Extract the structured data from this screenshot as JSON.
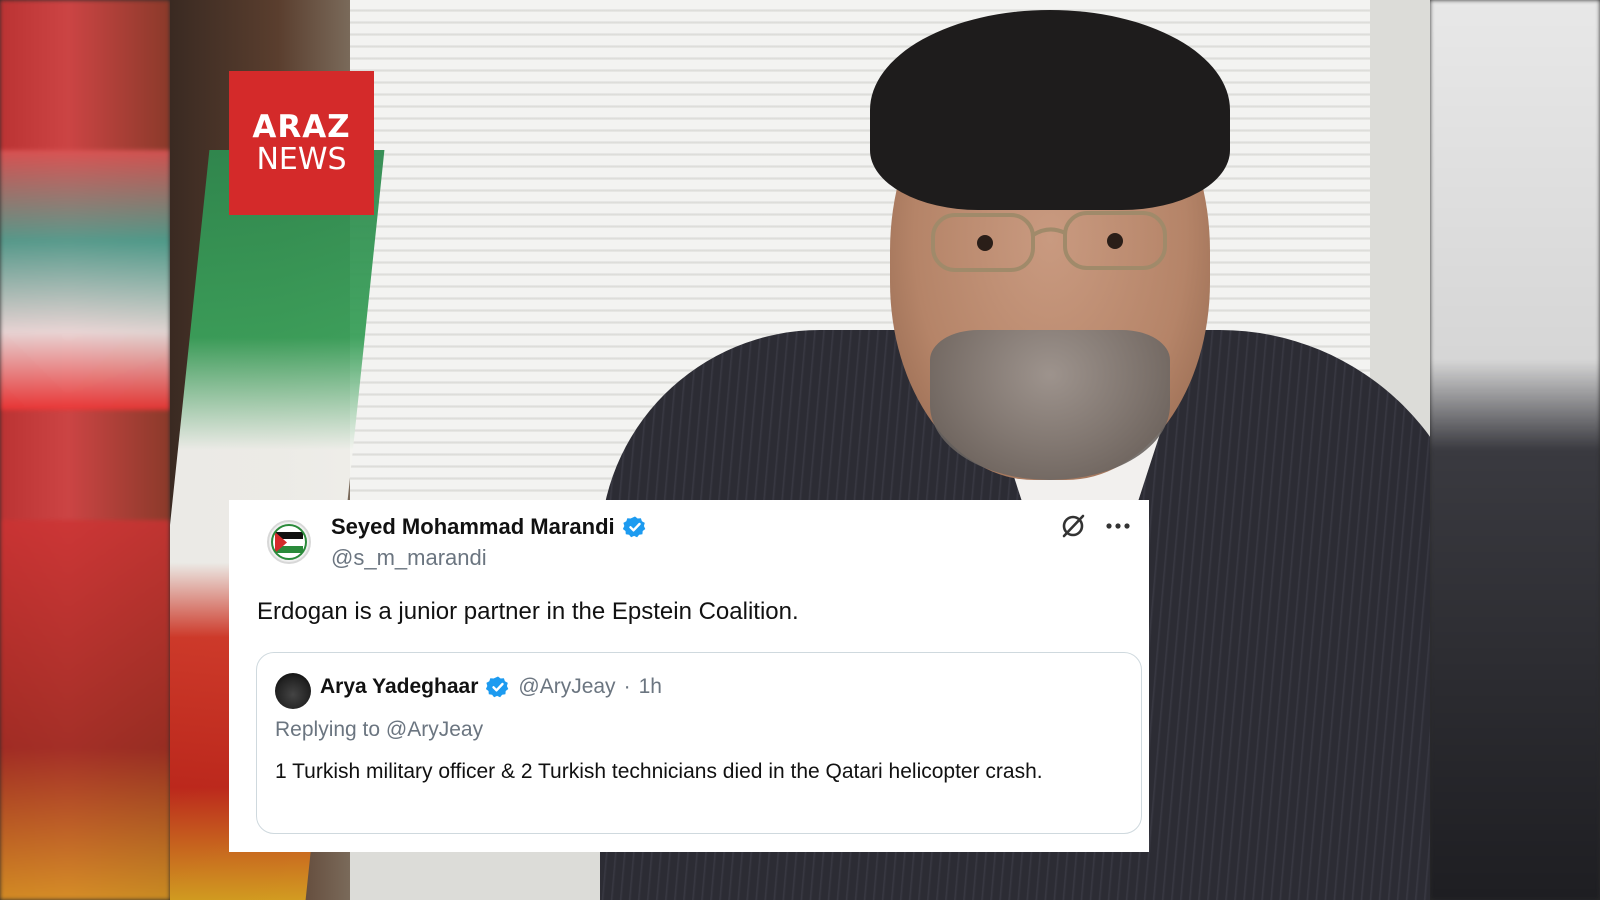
{
  "logo": {
    "line1": "ARAZ",
    "line2": "NEWS",
    "color": "#d42a2a"
  },
  "tweet": {
    "author_name": "Seyed Mohammad Marandi",
    "author_handle": "@s_m_marandi",
    "text": "Erdogan is a junior partner in the Epstein Coalition.",
    "icons": [
      "grok-icon",
      "more-icon"
    ],
    "quoted": {
      "author_name": "Arya Yadeghaar",
      "author_handle": "@AryJeay",
      "separator": "·",
      "time": "1h",
      "replying_to": "Replying to @AryJeay",
      "text": "1 Turkish military officer & 2 Turkish technicians died in the Qatari helicopter crash."
    }
  },
  "colors": {
    "verified_blue": "#1d9bf0",
    "muted_text": "#6b7580"
  }
}
